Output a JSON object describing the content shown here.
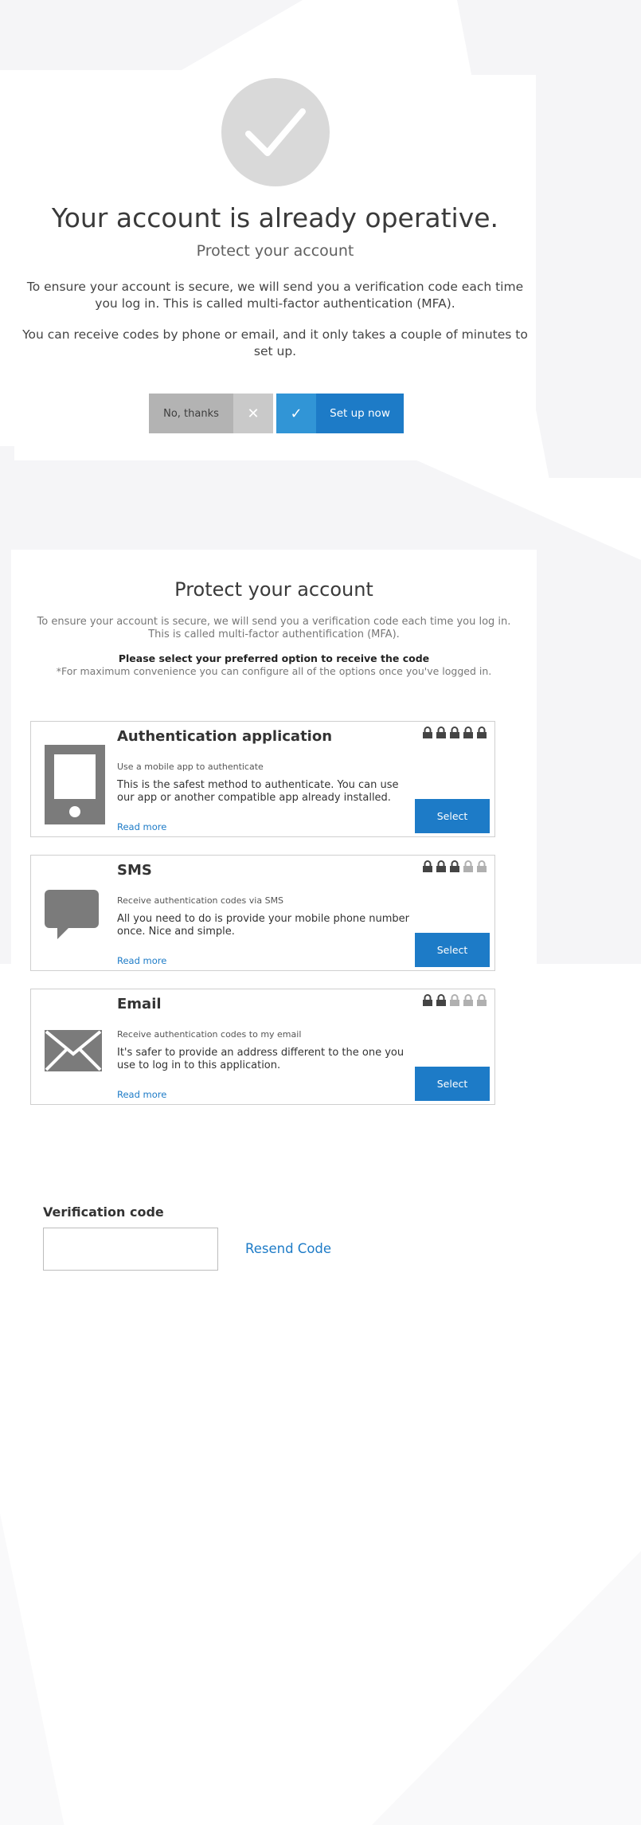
{
  "colors": {
    "accent": "#1d7bc7",
    "accent_light": "#3195d6",
    "secondary_button": "#b3b3b3",
    "lock_active": "#444444",
    "lock_inactive": "#b0b0b0"
  },
  "card1": {
    "icon": "check-icon",
    "title": "Your account is already operative.",
    "subtitle": "Protect your account",
    "paragraph1": "To ensure your account is secure, we will send you a verification code each time you log in. This is called multi-factor authentication (MFA).",
    "paragraph2": "You can receive codes by phone or email, and it only takes a couple of minutes to set up.",
    "no_button": {
      "label": "No, thanks",
      "icon": "close-icon",
      "glyph": "✕"
    },
    "yes_button": {
      "label": "Set up now",
      "icon": "check-icon",
      "glyph": "✓"
    }
  },
  "card2": {
    "title": "Protect your account",
    "intro": "To ensure your account is secure, we will send you a verification code each time you log in. This is called multi-factor authentification (MFA).",
    "select_prompt": "Please select your preferred option to receive the code",
    "note": "*For maximum convenience you can configure all of the options once you've logged in.",
    "options": [
      {
        "title": "Authentication application",
        "icon": "smartphone-icon",
        "description": "Use a mobile app to authenticate",
        "body": "This is the safest method to authenticate. You can use our app or another compatible app already installed.",
        "read_more": "Read more",
        "button": "Select",
        "security_level": 5,
        "security_max": 5
      },
      {
        "title": "SMS",
        "icon": "speech-bubble-icon",
        "description": "Receive authentication codes via SMS",
        "body": "All you need to do is provide your mobile phone number once. Nice and simple.",
        "read_more": "Read more",
        "button": "Select",
        "security_level": 3,
        "security_max": 5
      },
      {
        "title": "Email",
        "icon": "envelope-icon",
        "description": "Receive authentication codes to my email",
        "body": "It's safer to provide an address different to the one you use to log in to this application.",
        "read_more": "Read more",
        "button": "Select",
        "security_level": 2,
        "security_max": 5
      }
    ]
  },
  "verification": {
    "label": "Verification code",
    "value": "",
    "resend": "Resend Code"
  }
}
